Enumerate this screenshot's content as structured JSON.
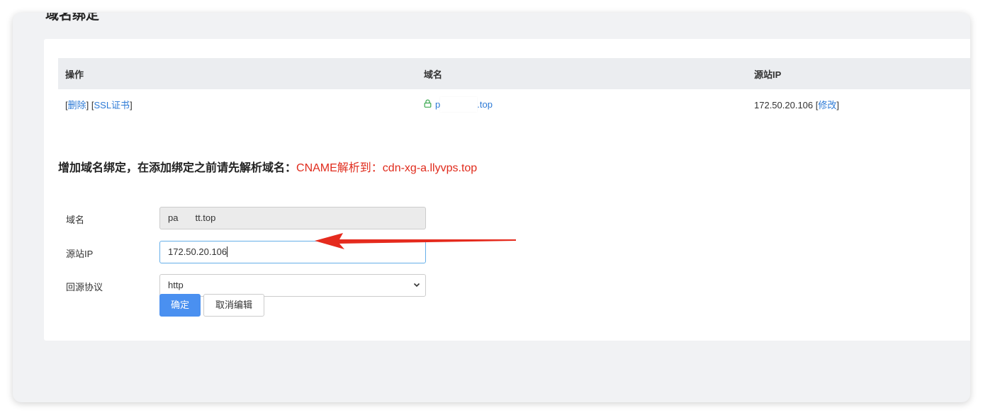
{
  "section": {
    "title": "域名绑定"
  },
  "table": {
    "headers": [
      "操作",
      "域名",
      "源站IP"
    ],
    "rows": [
      {
        "actions": {
          "delete": "删除",
          "ssl": "SSL证书"
        },
        "domain_prefix": "p",
        "domain_suffix": ".top",
        "origin_ip": "172.50.20.106",
        "edit": "修改"
      }
    ]
  },
  "add_form": {
    "title": "增加域名绑定，在添加绑定之前请先解析域名：",
    "cname": "CNAME解析到：cdn-xg-a.llyvps.top",
    "domain_label": "域名",
    "domain_value_a": "pa",
    "domain_value_b": "tt.top",
    "ip_label": "源站IP",
    "ip_value": "172.50.20.106",
    "protocol_label": "回源协议",
    "protocol_value": "http",
    "confirm_button": "确定",
    "cancel_button": "取消编辑"
  },
  "icons": {
    "lock": "lock-icon",
    "select": "chevron-down-icon",
    "annotation": "red-arrow-annotation"
  },
  "colors": {
    "link": "#2d7ad6",
    "cname": "#e02b1c",
    "primary": "#4a90f0",
    "arrow": "#e52b1e"
  }
}
